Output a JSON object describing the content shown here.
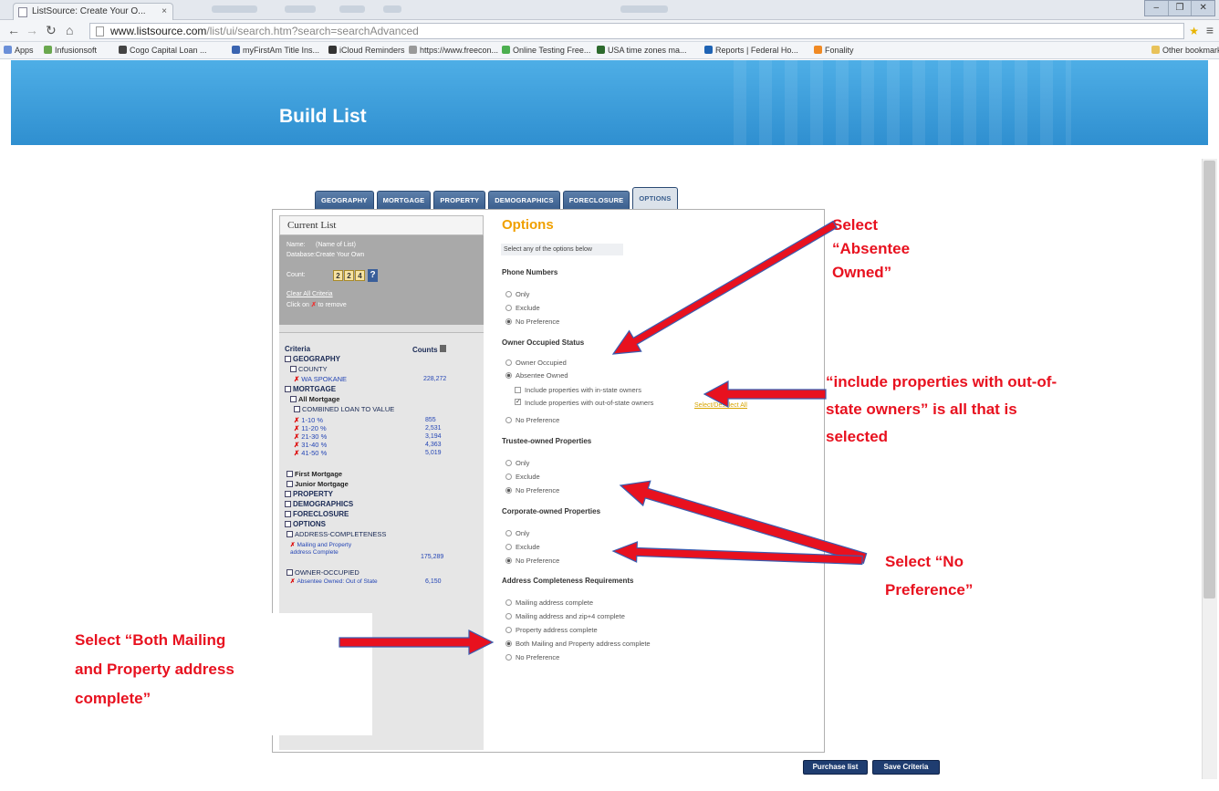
{
  "browser": {
    "tab_title": "ListSource: Create Your O...",
    "tab_close": "×",
    "url_domain": "www.listsource.com",
    "url_path": "/list/ui/search.htm?search=searchAdvanced",
    "window_controls": [
      "–",
      "❐",
      "✕"
    ],
    "bookmarks": [
      "Apps",
      "Infusionsoft",
      "Cogo Capital Loan ...",
      "myFirstAm Title Ins...",
      "iCloud Reminders",
      "https://www.freecon...",
      "Online Testing Free...",
      "USA time zones ma...",
      "Reports | Federal Ho...",
      "Fonality"
    ],
    "other_bookmarks": "Other bookmarks"
  },
  "page": {
    "banner_title": "Build List",
    "tabs": [
      "GEOGRAPHY",
      "MORTGAGE",
      "PROPERTY",
      "DEMOGRAPHICS",
      "FORECLOSURE",
      "OPTIONS"
    ],
    "active_tab": "OPTIONS"
  },
  "current_list": {
    "title": "Current List",
    "name_label": "Name:",
    "name_value": "(Name of List)",
    "database_label": "Database:",
    "database_value": "Create Your Own",
    "count_label": "Count:",
    "count_digits": [
      "2",
      "2",
      "4"
    ],
    "help": "?",
    "clear_all": "Clear All Criteria",
    "click_on": "Click on",
    "to_remove": "to remove"
  },
  "criteria": {
    "header_left": "Criteria",
    "header_right": "Counts",
    "rows": {
      "geography": "GEOGRAPHY",
      "county": "COUNTY",
      "wa_spokane": "WA SPOKANE",
      "wa_spokane_count": "228,272",
      "mortgage": "MORTGAGE",
      "all_mortgage": "All Mortgage",
      "cltv": "COMBINED LOAN TO VALUE",
      "ltv_ranges": [
        "1-10 %",
        "11-20 %",
        "21-30 %",
        "31-40 %",
        "41-50 %"
      ],
      "ltv_counts": [
        "855",
        "2,531",
        "3,194",
        "4,363",
        "5,019"
      ],
      "first_mortgage": "First Mortgage",
      "junior_mortgage": "Junior Mortgage",
      "property": "PROPERTY",
      "demographics": "DEMOGRAPHICS",
      "foreclosure": "FORECLOSURE",
      "options": "OPTIONS",
      "address_completeness": "ADDRESS-COMPLETENESS",
      "mailing_property": "Mailing and Property address Complete",
      "mailing_property_count": "175,289",
      "owner_occupied": "OWNER-OCCUPIED",
      "absentee_out_of_state": "Absentee Owned: Out of State",
      "absentee_count": "6,150"
    }
  },
  "options": {
    "title": "Options",
    "subtitle": "Select any of the options below",
    "phone_numbers": {
      "title": "Phone Numbers",
      "items": [
        "Only",
        "Exclude",
        "No Preference"
      ]
    },
    "owner_occupied": {
      "title": "Owner Occupied Status",
      "items": [
        "Owner Occupied",
        "Absentee Owned",
        "Include properties with in-state owners",
        "Include properties with out-of-state owners",
        "No Preference"
      ],
      "select_all": "Select/Deselect All"
    },
    "trustee": {
      "title": "Trustee-owned Properties",
      "items": [
        "Only",
        "Exclude",
        "No Preference"
      ]
    },
    "corporate": {
      "title": "Corporate-owned Properties",
      "items": [
        "Only",
        "Exclude",
        "No Preference"
      ]
    },
    "address": {
      "title": "Address Completeness Requirements",
      "items": [
        "Mailing address complete",
        "Mailing address and zip+4 complete",
        "Property address complete",
        "Both Mailing and Property address complete",
        "No Preference"
      ]
    }
  },
  "buttons": {
    "purchase": "Purchase list",
    "save": "Save Criteria"
  },
  "annotations": {
    "absentee": [
      "Select “Absentee",
      "Owned”"
    ],
    "out_of_state": [
      "“include properties with out-of-",
      "state owners” is all that is",
      "selected"
    ],
    "no_preference": [
      "Select “No",
      "Preference”"
    ],
    "both_mailing": [
      "Select “Both Mailing",
      "and Property address",
      "complete”"
    ],
    "arrow_color": "#e8111f"
  }
}
